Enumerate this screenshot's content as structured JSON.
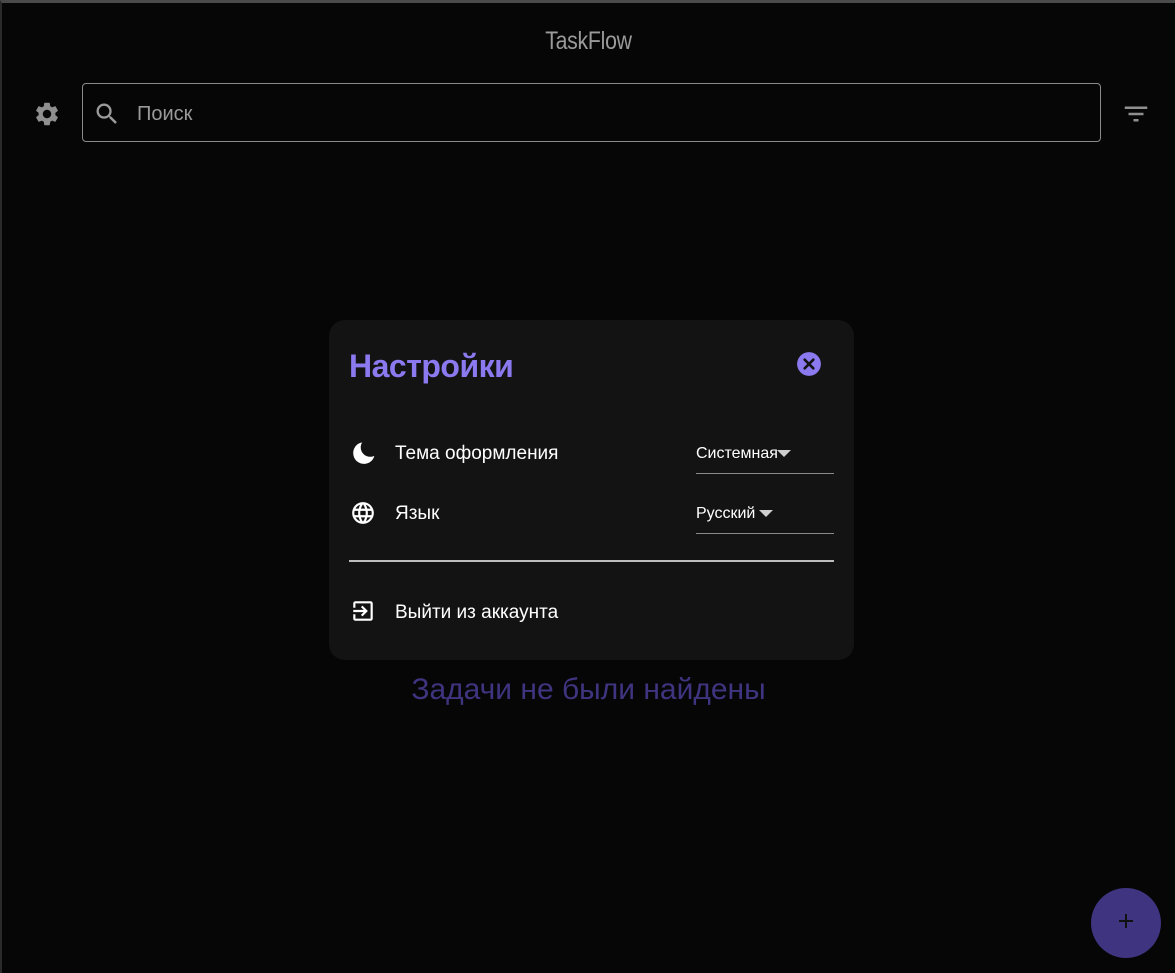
{
  "app": {
    "title": "TaskFlow"
  },
  "toolbar": {
    "settings_icon": "gear-icon",
    "search": {
      "placeholder": "Поиск",
      "value": "",
      "icon": "search-icon"
    },
    "filter_icon": "filter-icon"
  },
  "main": {
    "empty_message": "Задачи не были найдены"
  },
  "fab": {
    "icon": "plus-icon"
  },
  "settings_dialog": {
    "title": "Настройки",
    "close_icon": "close-circle-icon",
    "theme": {
      "icon": "moon-icon",
      "label": "Тема оформления",
      "value": "Системная"
    },
    "language": {
      "icon": "globe-icon",
      "label": "Язык",
      "value": "Русский"
    },
    "logout": {
      "icon": "logout-icon",
      "label": "Выйти из аккаунта"
    }
  },
  "colors": {
    "background": "#060606",
    "dialog_background": "#131313",
    "accent": "#8b79f0",
    "muted_accent": "#3f3480",
    "title_text": "#9a9a9a"
  }
}
